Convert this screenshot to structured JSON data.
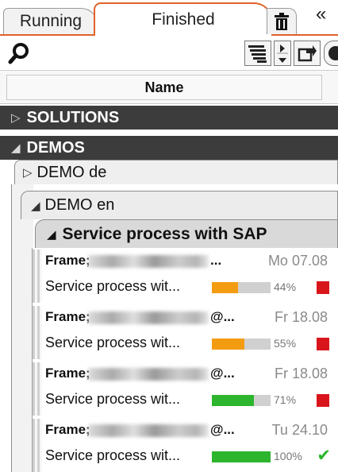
{
  "tabs": {
    "running": "Running",
    "finished": "Finished",
    "collapse": "«"
  },
  "columns": {
    "name": "Name"
  },
  "groups": {
    "solutions": "SOLUTIONS",
    "demos": "DEMOS",
    "demo_de": "DEMO de",
    "demo_en": "DEMO en",
    "service_group": "Service process with SAP"
  },
  "items": [
    {
      "frame": "Frame;",
      "frame_end": "...",
      "date": "Mo 07.08",
      "service": "Service process wit...",
      "progress": 0.44,
      "percent": "44%",
      "bar_color": "#f39c12",
      "status": "error"
    },
    {
      "frame": "Frame;",
      "frame_end": "@...",
      "date": "Fr 18.08",
      "service": "Service process wit...",
      "progress": 0.55,
      "percent": "55%",
      "bar_color": "#f39c12",
      "status": "error"
    },
    {
      "frame": "Frame;",
      "frame_end": "@...",
      "date": "Fr 18.08",
      "service": "Service process wit...",
      "progress": 0.71,
      "percent": "71%",
      "bar_color": "#2db52d",
      "status": "error"
    },
    {
      "frame": "Frame;",
      "frame_end": "@...",
      "date": "Tu 24.10",
      "service": "Service process wit...",
      "progress": 1.0,
      "percent": "100%",
      "bar_color": "#2db52d",
      "status": "done"
    }
  ],
  "colors": {
    "accent": "#e0622a",
    "group_dark": "#3c3c3c",
    "error": "#d9151c",
    "success": "#2ab52a"
  },
  "icons": {
    "trash": "trash-icon",
    "search": "search-icon",
    "filter": "filter-list-icon",
    "sort": "sort-arrows-icon",
    "export": "export-icon"
  }
}
